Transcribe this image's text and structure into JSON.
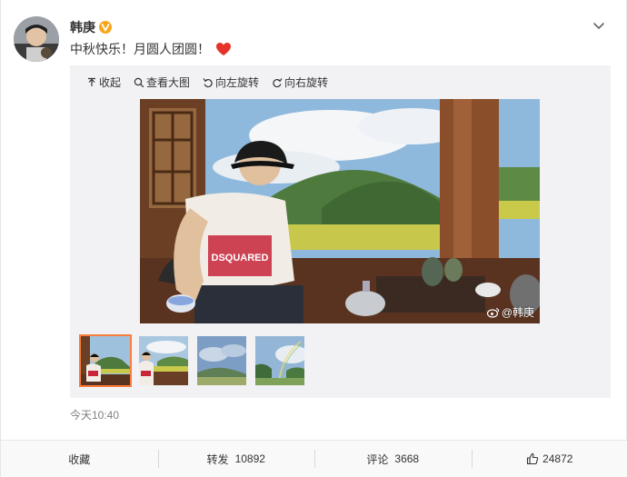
{
  "post": {
    "author": "韩庚",
    "text": "中秋快乐！月圆人团圆！",
    "timestamp": "今天10:40"
  },
  "toolbar": {
    "collapse": "收起",
    "view_large": "查看大图",
    "rotate_left": "向左旋转",
    "rotate_right": "向右旋转"
  },
  "photo": {
    "shirt_text": "DSQUARED",
    "watermark": "@韩庚"
  },
  "thumbnails": [
    {
      "name": "thumb-1",
      "active": true
    },
    {
      "name": "thumb-2",
      "active": false
    },
    {
      "name": "thumb-3",
      "active": false
    },
    {
      "name": "thumb-4",
      "active": false
    }
  ],
  "actions": {
    "favorite_label": "收藏",
    "repost_label": "转发",
    "repost_count": "10892",
    "comment_label": "评论",
    "comment_count": "3668",
    "like_count": "24872"
  },
  "colors": {
    "accent": "#fa7d3c",
    "verified": "#f8a61b",
    "heart": "#e5332a"
  }
}
